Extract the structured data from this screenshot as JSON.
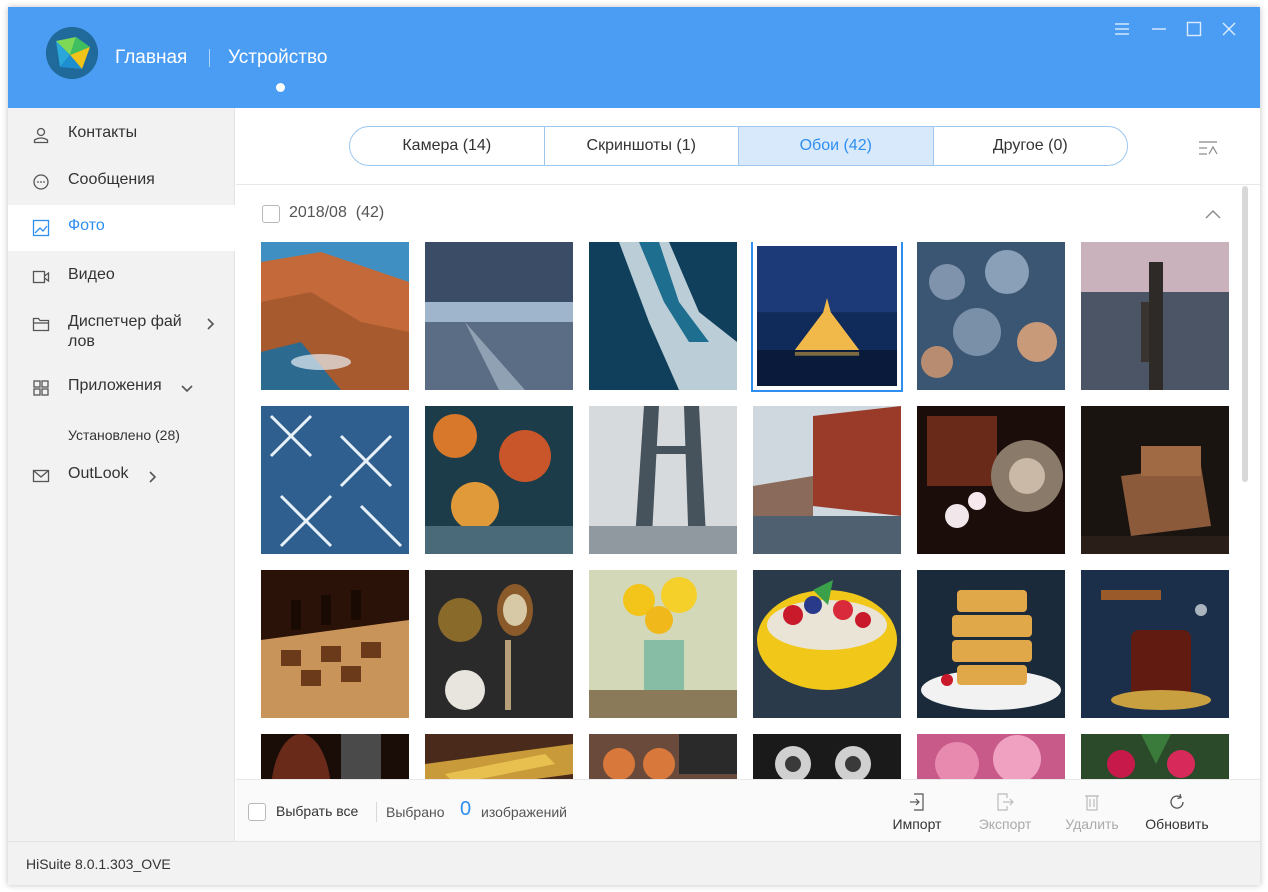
{
  "header": {
    "nav_main": "Главная",
    "nav_device": "Устройство",
    "accent": "#4b9df4"
  },
  "window_controls": [
    "menu-icon",
    "minimize-icon",
    "maximize-icon",
    "close-icon"
  ],
  "sidebar": {
    "items": [
      {
        "label": "Контакты",
        "icon": "contacts-icon"
      },
      {
        "label": "Сообщения",
        "icon": "messages-icon"
      },
      {
        "label": "Фото",
        "icon": "photo-icon",
        "active": true
      },
      {
        "label": "Видео",
        "icon": "video-icon"
      },
      {
        "label": "Диспетчер фай",
        "label2": "лов",
        "icon": "folder-icon"
      },
      {
        "label": "Приложения",
        "icon": "apps-icon"
      },
      {
        "label": "OutLook",
        "icon": "mail-icon"
      }
    ],
    "sub_installed": "Установлено (28)"
  },
  "tabs": [
    {
      "label": "Камера (14)"
    },
    {
      "label": "Скриншоты (1)"
    },
    {
      "label": "Обои (42)",
      "active": true
    },
    {
      "label": "Другое (0)"
    }
  ],
  "group": {
    "date": "2018/08",
    "count": "(42)"
  },
  "thumbnails": [
    {
      "subject": "coastal rocks"
    },
    {
      "subject": "cloudy sky"
    },
    {
      "subject": "ocean waves"
    },
    {
      "subject": "castle at night",
      "selected": true
    },
    {
      "subject": "cloud pattern"
    },
    {
      "subject": "sea pier"
    },
    {
      "subject": "frost crystals"
    },
    {
      "subject": "autumn leaves"
    },
    {
      "subject": "bridge tower"
    },
    {
      "subject": "canal buildings"
    },
    {
      "subject": "flowers plate"
    },
    {
      "subject": "chair interior"
    },
    {
      "subject": "chess board"
    },
    {
      "subject": "spices spoons"
    },
    {
      "subject": "daffodils vase"
    },
    {
      "subject": "berries bowl"
    },
    {
      "subject": "waffles"
    },
    {
      "subject": "tea glass"
    },
    {
      "subject": "violin"
    },
    {
      "subject": "brass instrument"
    },
    {
      "subject": "tea cups"
    },
    {
      "subject": "machine gears"
    },
    {
      "subject": "pink peonies"
    },
    {
      "subject": "red roses"
    }
  ],
  "bottom": {
    "select_all": "Выбрать все",
    "selected_prefix": "Выбрано",
    "selected_count": "0",
    "selected_suffix": "изображений",
    "actions": [
      {
        "label": "Импорт",
        "icon": "import-icon",
        "enabled": true
      },
      {
        "label": "Экспорт",
        "icon": "export-icon",
        "enabled": false
      },
      {
        "label": "Удалить",
        "icon": "delete-icon",
        "enabled": false
      },
      {
        "label": "Обновить",
        "icon": "refresh-icon",
        "enabled": true
      }
    ]
  },
  "status": {
    "version": "HiSuite 8.0.1.303_OVE"
  }
}
